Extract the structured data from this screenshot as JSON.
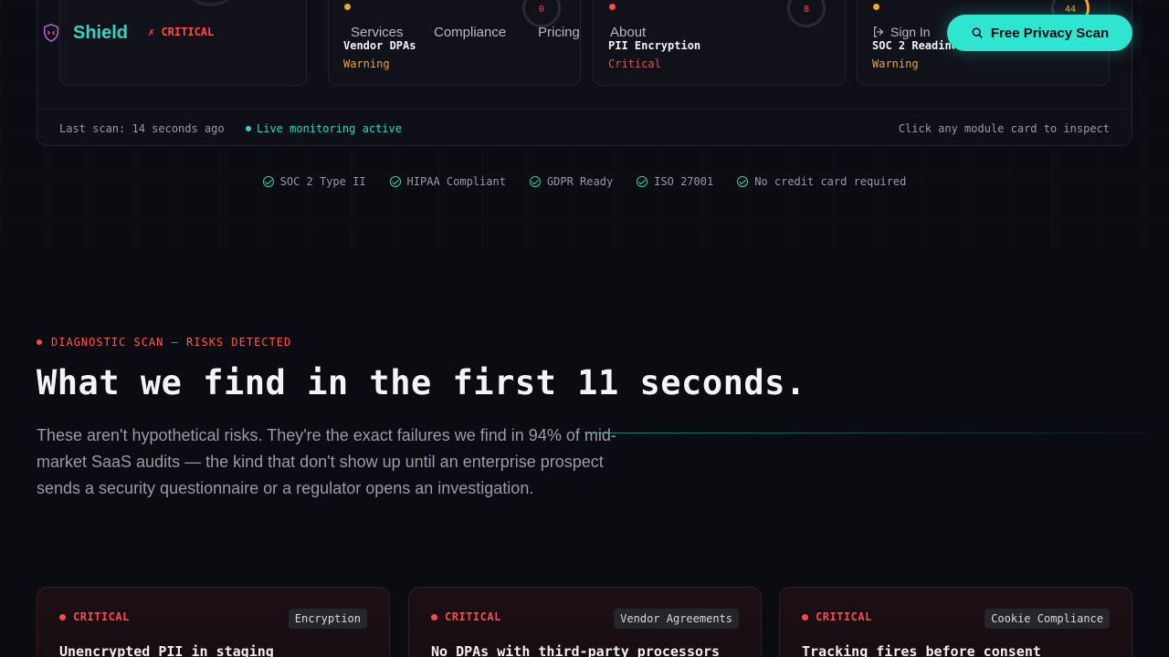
{
  "nav": {
    "brand": "Shield",
    "status_flag": "✗ CRITICAL",
    "links": [
      "Services",
      "Compliance",
      "Pricing",
      "About"
    ],
    "sign_in": "Sign In",
    "cta": "Free Privacy Scan"
  },
  "dashboard": {
    "modules": [
      {
        "title": "Vendor DPAs",
        "status": "Warning",
        "score": "0"
      },
      {
        "title": "PII Encryption",
        "status": "Critical",
        "score": "8"
      },
      {
        "title": "SOC 2 Readiness",
        "status": "Warning",
        "score": "44"
      }
    ],
    "last_scan": "Last scan: 14 seconds ago",
    "live": "Live monitoring active",
    "hint": "Click any module card to inspect"
  },
  "badges": [
    "SOC 2 Type II",
    "HIPAA Compliant",
    "GDPR Ready",
    "ISO 27001",
    "No credit card required"
  ],
  "section": {
    "eyebrow": "DIAGNOSTIC SCAN — RISKS DETECTED",
    "headline": "What we find in the first 11 seconds.",
    "lead": "These aren't hypothetical risks. They're the exact failures we find in 94% of mid-market SaaS audits — the kind that don't show up until an enterprise prospect sends a security questionnaire or a regulator opens an investigation."
  },
  "risks": [
    {
      "severity": "CRITICAL",
      "tag": "Encryption",
      "title": "Unencrypted PII in staging"
    },
    {
      "severity": "CRITICAL",
      "tag": "Vendor Agreements",
      "title": "No DPAs with third-party processors"
    },
    {
      "severity": "CRITICAL",
      "tag": "Cookie Compliance",
      "title": "Tracking fires before consent"
    }
  ],
  "colors": {
    "accent": "#2ee6cf",
    "critical": "#ff4a4a",
    "warning": "#f5a623",
    "background": "#0b0b12"
  }
}
